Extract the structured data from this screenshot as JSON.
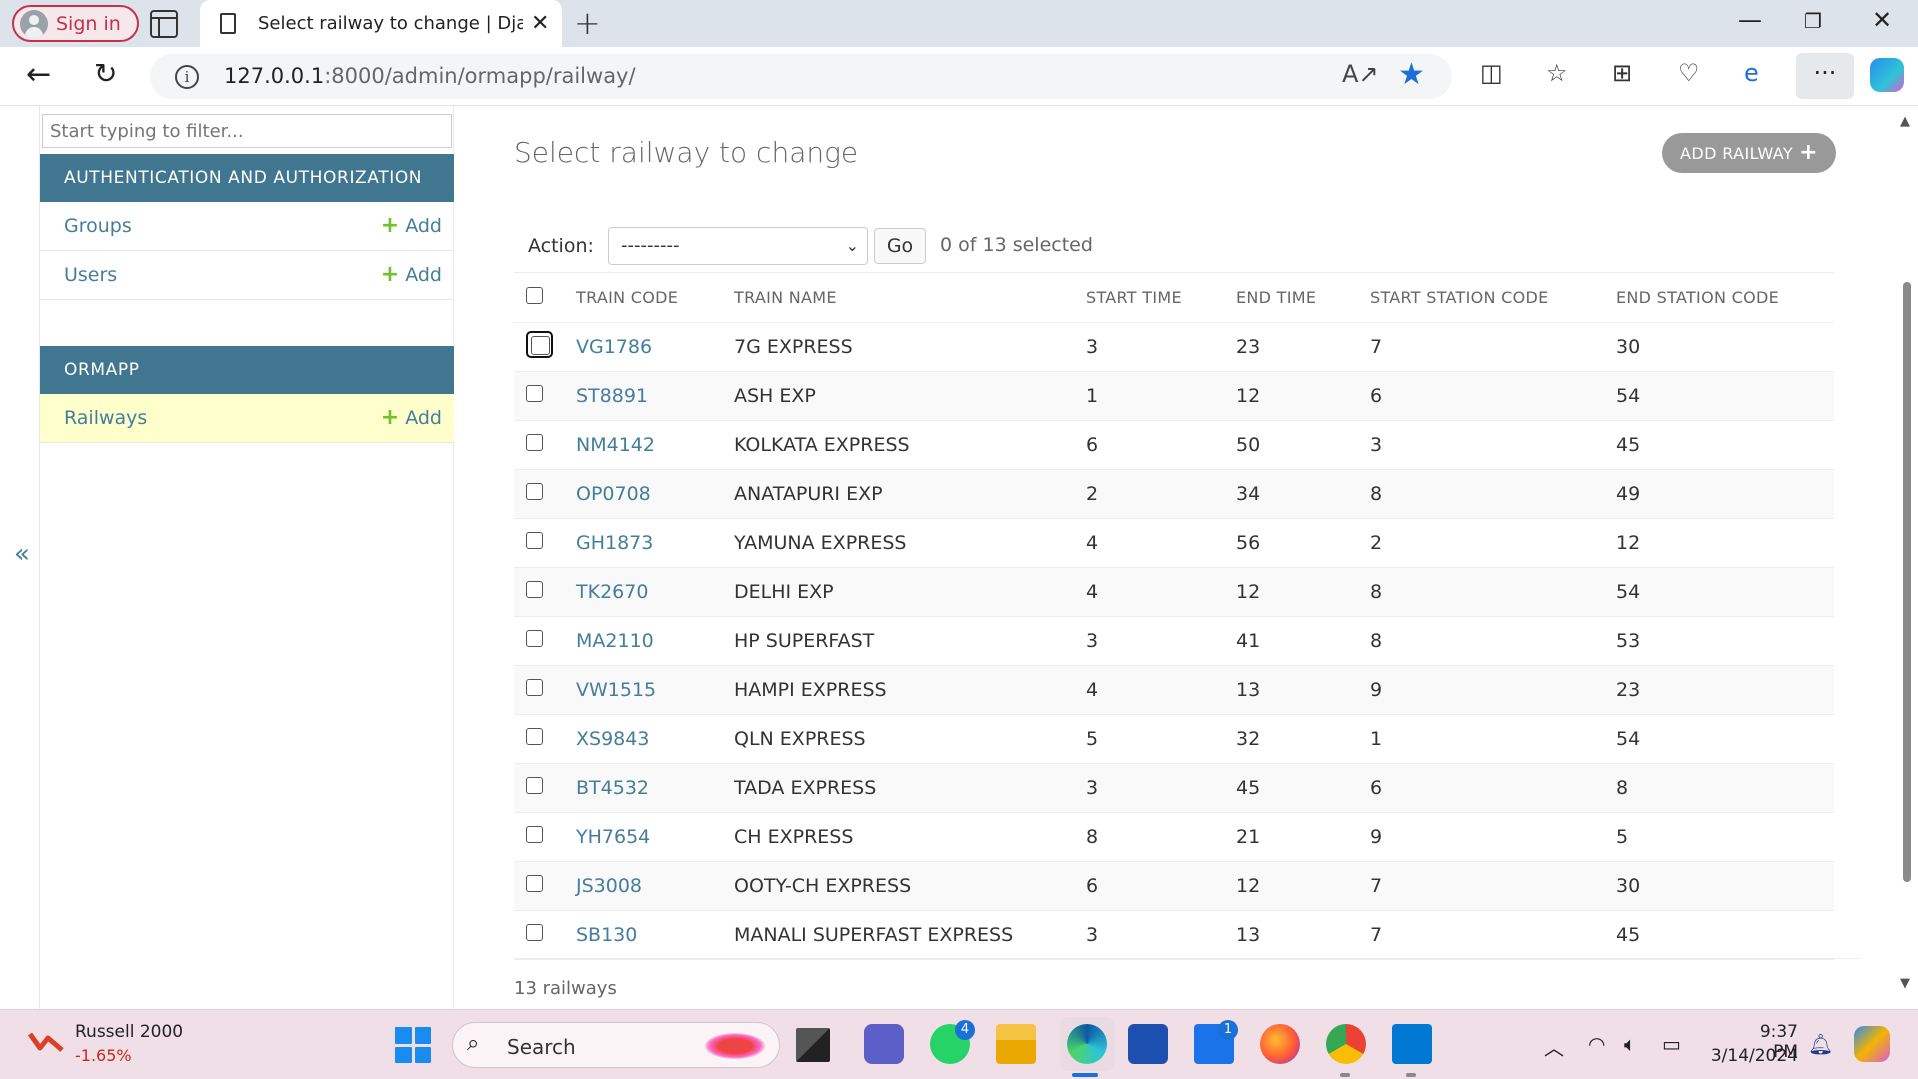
{
  "browser": {
    "sign_in_label": "Sign in",
    "tab_title": "Select railway to change | Django site admin",
    "url_host": "127.0.0.1",
    "url_rest": ":8000/admin/ormapp/railway/"
  },
  "sidebar": {
    "filter_placeholder": "Start typing to filter...",
    "modules": [
      {
        "caption": "AUTHENTICATION AND AUTHORIZATION",
        "models": [
          {
            "name": "Groups",
            "add_label": "Add"
          },
          {
            "name": "Users",
            "add_label": "Add"
          }
        ]
      },
      {
        "caption": "ORMAPP",
        "models": [
          {
            "name": "Railways",
            "add_label": "Add",
            "current": true
          }
        ]
      }
    ],
    "collapse_label": "«"
  },
  "content": {
    "title": "Select railway to change",
    "add_button_label": "ADD RAILWAY",
    "action_label": "Action:",
    "action_selected": "---------",
    "go_label": "Go",
    "selected_count": "0 of 13 selected",
    "columns": [
      "TRAIN CODE",
      "TRAIN NAME",
      "START TIME",
      "END TIME",
      "START STATION CODE",
      "END STATION CODE"
    ],
    "rows": [
      [
        "VG1786",
        "7G EXPRESS",
        "3",
        "23",
        "7",
        "30"
      ],
      [
        "ST8891",
        "ASH EXP",
        "1",
        "12",
        "6",
        "54"
      ],
      [
        "NM4142",
        "KOLKATA EXPRESS",
        "6",
        "50",
        "3",
        "45"
      ],
      [
        "OP0708",
        "ANATAPURI EXP",
        "2",
        "34",
        "8",
        "49"
      ],
      [
        "GH1873",
        "YAMUNA EXPRESS",
        "4",
        "56",
        "2",
        "12"
      ],
      [
        "TK2670",
        "DELHI EXP",
        "4",
        "12",
        "8",
        "54"
      ],
      [
        "MA2110",
        "HP SUPERFAST",
        "3",
        "41",
        "8",
        "53"
      ],
      [
        "VW1515",
        "HAMPI EXPRESS",
        "4",
        "13",
        "9",
        "23"
      ],
      [
        "XS9843",
        "QLN EXPRESS",
        "5",
        "32",
        "1",
        "54"
      ],
      [
        "BT4532",
        "TADA EXPRESS",
        "3",
        "45",
        "6",
        "8"
      ],
      [
        "YH7654",
        "CH EXPRESS",
        "8",
        "21",
        "9",
        "5"
      ],
      [
        "JS3008",
        "OOTY-CH EXPRESS",
        "6",
        "12",
        "7",
        "30"
      ],
      [
        "SB130",
        "MANALI SUPERFAST EXPRESS",
        "3",
        "13",
        "7",
        "45"
      ]
    ],
    "paginator": "13 railways"
  },
  "taskbar": {
    "widget_name": "Russell 2000",
    "widget_value": "-1.65%",
    "search_label": "Search",
    "whatsapp_badge": "4",
    "mail_badge": "1",
    "time": "9:37 PM",
    "date": "3/14/2024"
  },
  "colors": {
    "module_header": "#417690",
    "link": "#447e9b",
    "add_plus": "#70bf2b",
    "current_row": "#ffffcc",
    "accent": "#1a6fd8"
  }
}
